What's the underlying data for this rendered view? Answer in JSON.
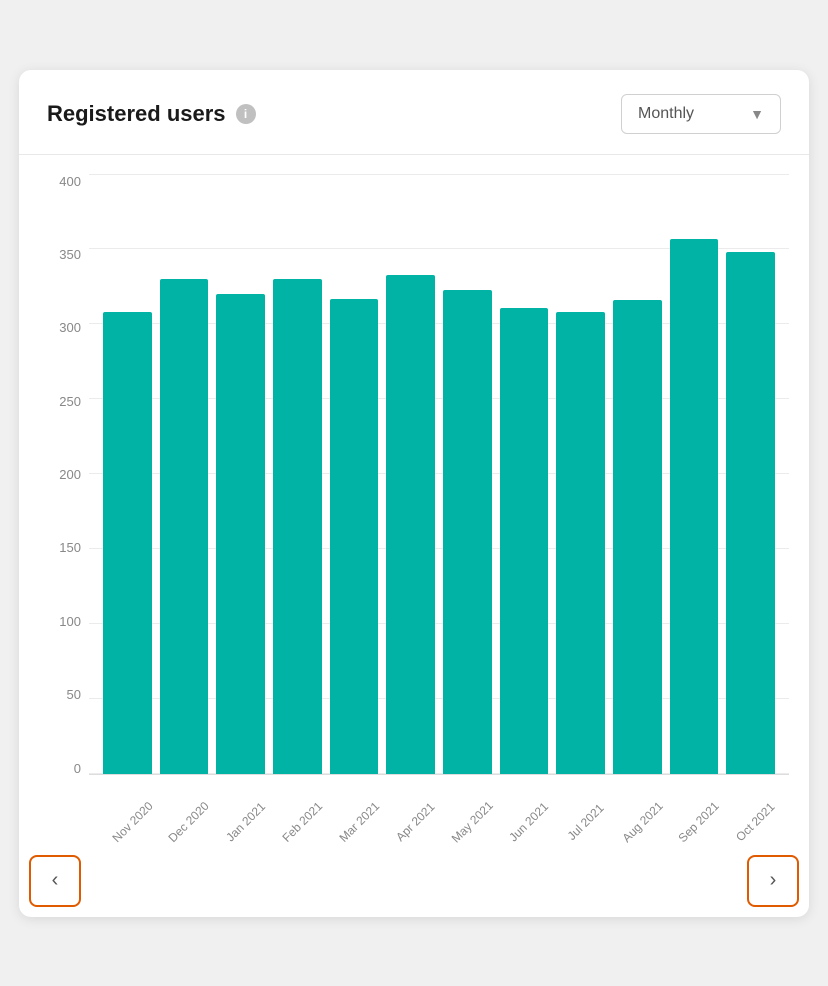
{
  "header": {
    "title": "Registered users",
    "info_icon_label": "i",
    "dropdown_label": "Monthly",
    "dropdown_arrow": "▼"
  },
  "chart": {
    "y_labels": [
      "0",
      "50",
      "100",
      "150",
      "200",
      "250",
      "300",
      "350",
      "400"
    ],
    "bar_color": "#00b3a4",
    "max_value": 400,
    "bars": [
      {
        "month": "Nov 2020",
        "value": 308
      },
      {
        "month": "Dec 2020",
        "value": 330
      },
      {
        "month": "Jan 2021",
        "value": 320
      },
      {
        "month": "Feb 2021",
        "value": 330
      },
      {
        "month": "Mar 2021",
        "value": 317
      },
      {
        "month": "Apr 2021",
        "value": 333
      },
      {
        "month": "May 2021",
        "value": 323
      },
      {
        "month": "Jun 2021",
        "value": 311
      },
      {
        "month": "Jul 2021",
        "value": 308
      },
      {
        "month": "Aug 2021",
        "value": 316
      },
      {
        "month": "Sep 2021",
        "value": 357
      },
      {
        "month": "Oct 2021",
        "value": 348
      }
    ]
  },
  "nav": {
    "prev_label": "‹",
    "next_label": "›"
  }
}
